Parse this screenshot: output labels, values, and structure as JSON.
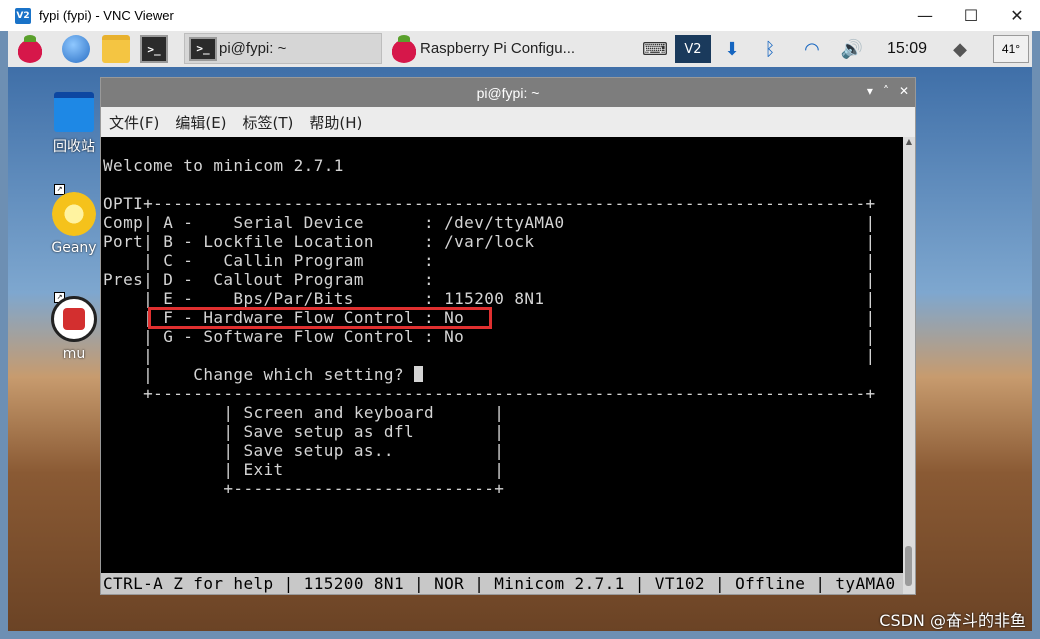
{
  "vnc": {
    "logo": "V2",
    "title": "fypi (fypi) - VNC Viewer",
    "controls": [
      "—",
      "☐",
      "✕"
    ]
  },
  "taskbar": {
    "task_terminal": "pi@fypi: ~",
    "task_config": "Raspberry Pi Configu...",
    "clock": "15:09",
    "temp": "41°"
  },
  "desktop": {
    "icons": [
      {
        "label": "回收站"
      },
      {
        "label": "Geany"
      },
      {
        "label": "mu"
      }
    ],
    "watermark": "CSDN @奋斗的非鱼"
  },
  "terminal": {
    "title": "pi@fypi: ~",
    "controls": [
      "▾",
      "˄",
      "✕"
    ],
    "menu": [
      "文件(F)",
      "编辑(E)",
      "标签(T)",
      "帮助(H)"
    ],
    "lines": [
      "",
      "Welcome to minicom 2.7.1",
      "",
      "OPTI+-----------------------------------------------------------------------+",
      "Comp| A -    Serial Device      : /dev/ttyAMA0                              |",
      "Port| B - Lockfile Location     : /var/lock                                 |",
      "    | C -   Callin Program      :                                           |",
      "Pres| D -  Callout Program      :                                           |",
      "    | E -    Bps/Par/Bits       : 115200 8N1                                |",
      "    | F - Hardware Flow Control : No                                        |",
      "    | G - Software Flow Control : No                                        |",
      "    |                                                                       |",
      "    |    Change which setting? ",
      "    +-----------------------------------------------------------------------+",
      "            | Screen and keyboard      |",
      "            | Save setup as dfl        |",
      "            | Save setup as..          |",
      "            | Exit                     |",
      "            +--------------------------+"
    ],
    "status": "CTRL-A Z for help | 115200 8N1 | NOR | Minicom 2.7.1 | VT102 | Offline | tyAMA0"
  }
}
